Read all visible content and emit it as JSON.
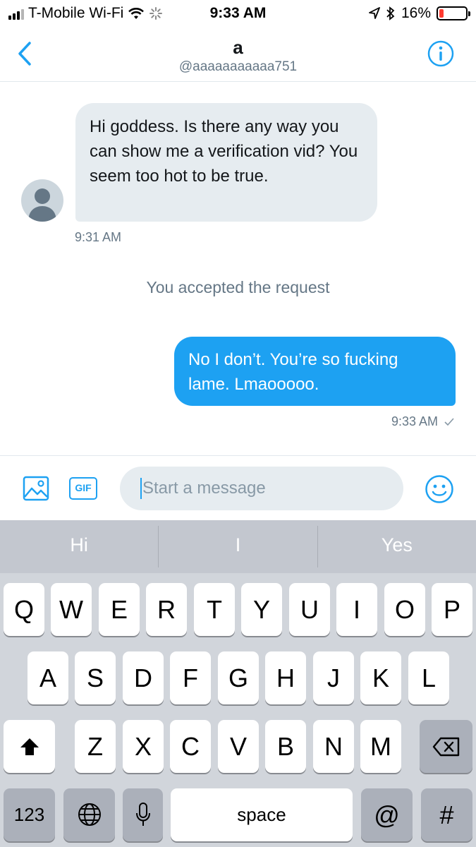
{
  "status_bar": {
    "carrier": "T-Mobile Wi-Fi",
    "time": "9:33 AM",
    "battery": "16%",
    "battery_level": 0.16
  },
  "header": {
    "name": "a",
    "handle": "@aaaaaaaaaaa751"
  },
  "messages": {
    "incoming_text": "Hi goddess. Is there any way you can show me a verification vid? You seem too hot to be true.",
    "incoming_time": "9:31 AM",
    "system_text": "You accepted the request",
    "outgoing_text": "No I don’t. You’re so fucking lame. Lmaooooo.",
    "outgoing_time": "9:33 AM"
  },
  "composer": {
    "gif_label": "GIF",
    "placeholder": "Start a message"
  },
  "keyboard": {
    "suggestions": [
      "Hi",
      "I",
      "Yes"
    ],
    "row1": [
      "Q",
      "W",
      "E",
      "R",
      "T",
      "Y",
      "U",
      "I",
      "O",
      "P"
    ],
    "row2": [
      "A",
      "S",
      "D",
      "F",
      "G",
      "H",
      "J",
      "K",
      "L"
    ],
    "row3": [
      "Z",
      "X",
      "C",
      "V",
      "B",
      "N",
      "M"
    ],
    "numbers_label": "123",
    "space_label": "space",
    "at_label": "@",
    "hash_label": "#"
  },
  "colors": {
    "accent": "#1da1f2",
    "bubble_incoming": "#e6ecf0",
    "secondary_text": "#657786"
  }
}
